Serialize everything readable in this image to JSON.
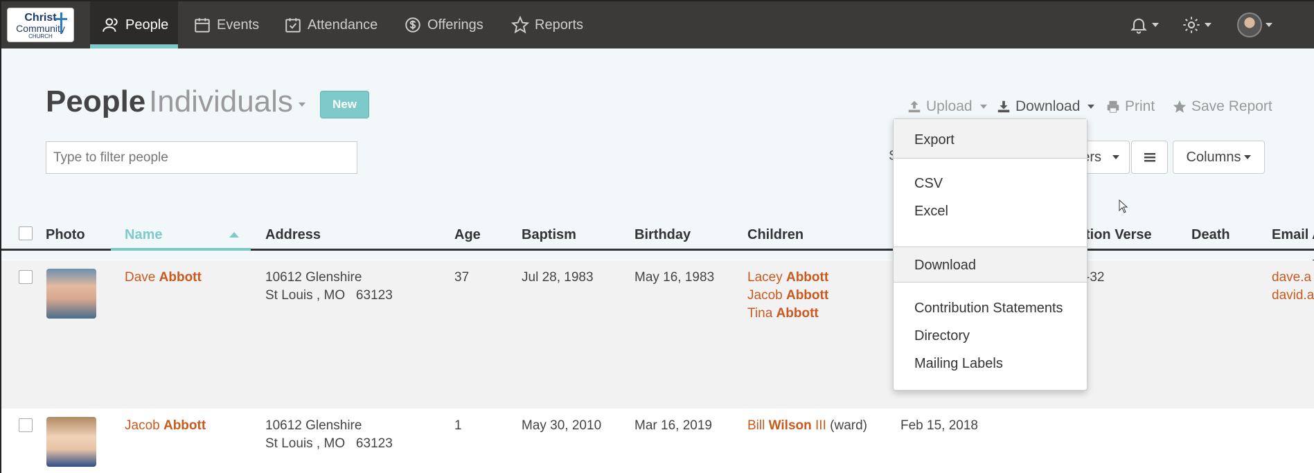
{
  "nav": {
    "logo": {
      "line1": "Christ",
      "line2": "Community",
      "line3": "CHURCH"
    },
    "items": [
      {
        "label": "People",
        "icon": "people-icon",
        "active": true
      },
      {
        "label": "Events",
        "icon": "calendar-icon"
      },
      {
        "label": "Attendance",
        "icon": "checkbox-calendar-icon"
      },
      {
        "label": "Offerings",
        "icon": "money-icon"
      },
      {
        "label": "Reports",
        "icon": "star-icon"
      }
    ]
  },
  "header": {
    "title": "People",
    "subtitle": "Individuals",
    "new_button": "New",
    "filter_placeholder": "Type to filter people"
  },
  "toolbar": {
    "upload": "Upload",
    "download": "Download",
    "print": "Print",
    "save_report": "Save Report",
    "partial_s": "S",
    "filters_partial": "ers",
    "columns": "Columns"
  },
  "dropdown": {
    "export": "Export",
    "csv": "CSV",
    "excel": "Excel",
    "download": "Download",
    "contribution_statements": "Contribution Statements",
    "directory": "Directory",
    "mailing_labels": "Mailing Labels"
  },
  "table": {
    "headers": {
      "photo": "Photo",
      "name": "Name",
      "address": "Address",
      "age": "Age",
      "baptism": "Baptism",
      "birthday": "Birthday",
      "children": "Children",
      "verse": "tion Verse",
      "death": "Death",
      "email": "Email A"
    },
    "rows": [
      {
        "first": "Dave",
        "last": "Abbott",
        "addr1": "10612 Glenshire",
        "addr2": "St Louis , MO   63123",
        "age": "37",
        "baptism": "Jul 28, 1983",
        "birthday": "May 16, 1983",
        "children": [
          {
            "first": "Lacey",
            "last": "Abbott"
          },
          {
            "first": "Jacob",
            "last": "Abbott"
          },
          {
            "first": "Tina",
            "last": "Abbott"
          }
        ],
        "verse": "-32",
        "email1": "dave.a",
        "email2": "david.a"
      },
      {
        "first": "Jacob",
        "last": "Abbott",
        "addr1": "10612 Glenshire",
        "addr2": "St Louis , MO   63123",
        "age": "1",
        "baptism": "May 30, 2010",
        "birthday": "Mar 16, 2019",
        "child_first": "Bill",
        "child_last": "Wilson",
        "child_suffix": "III",
        "child_note": "(ward)",
        "extra_date": "Feb 15, 2018"
      }
    ]
  },
  "colors": {
    "accent": "#7ecaca",
    "link": "#c95a1f",
    "nav_bg": "#3b3a38"
  }
}
